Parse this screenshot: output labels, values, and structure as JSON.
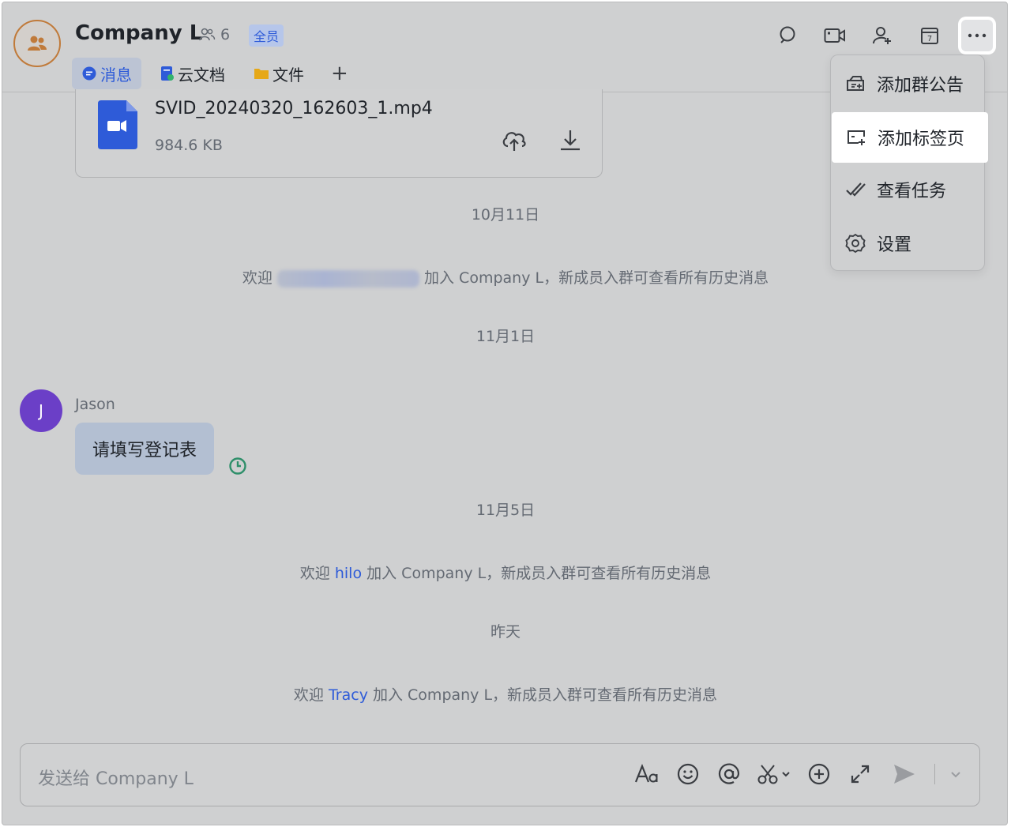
{
  "header": {
    "title": "Company L",
    "member_count": "6",
    "badge": "全员",
    "tabs": [
      {
        "label": "消息"
      },
      {
        "label": "云文档"
      },
      {
        "label": "文件"
      }
    ],
    "add_tab": "+"
  },
  "file": {
    "name": "SVID_20240320_162603_1.mp4",
    "size": "984.6 KB"
  },
  "dates": {
    "d1": "10月11日",
    "d2": "11月1日",
    "d3": "11月5日",
    "d4": "昨天"
  },
  "system": {
    "welcome": "欢迎",
    "join_text": "加入 Company L，新成员入群可查看所有历史消息",
    "user2": "hilo",
    "user3": "Tracy"
  },
  "message": {
    "avatar_letter": "J",
    "sender": "Jason",
    "text": "请填写登记表"
  },
  "input": {
    "placeholder": "发送给 Company L"
  },
  "menu": {
    "items": [
      {
        "label": "添加群公告"
      },
      {
        "label": "添加标签页"
      },
      {
        "label": "查看任务"
      },
      {
        "label": "设置"
      }
    ]
  },
  "colors": {
    "accent": "#2e5bd8",
    "avatar_purple": "#6b3fc7",
    "group_avatar_ring": "#c07a3a"
  }
}
